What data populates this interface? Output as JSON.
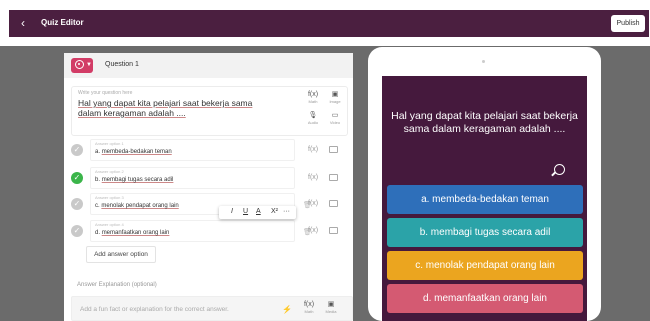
{
  "header": {
    "back_icon": "chevron-left-icon",
    "title": "Quiz Editor",
    "publish_label": "Publish"
  },
  "editor": {
    "question_number": "Question 1",
    "question_type_icon": "target-icon",
    "question_placeholder": "Write your question here",
    "question_text": "Hal yang dapat kita pelajari saat bekerja sama dalam keragaman adalah ....",
    "tools": [
      {
        "glyph": "f(x)",
        "label": "Math"
      },
      {
        "glyph": "▣",
        "label": "Image"
      },
      {
        "glyph": "🎙",
        "label": "Audio"
      },
      {
        "glyph": "▭",
        "label": "Video"
      }
    ],
    "answers": [
      {
        "placeholder": "Answer option 1",
        "prefix": "a.",
        "text": "membeda-bedakan teman",
        "correct": false
      },
      {
        "placeholder": "Answer option 2",
        "prefix": "b.",
        "text": "membagi tugas secara adil",
        "correct": true
      },
      {
        "placeholder": "Answer option 3",
        "prefix": "c.",
        "text": "menolak pendapat orang lain",
        "correct": false
      },
      {
        "placeholder": "Answer option 4",
        "prefix": "d.",
        "text": "memanfaatkan orang lain",
        "correct": false
      }
    ],
    "answer_fx": "f(x)",
    "format_bar": {
      "italic": "I",
      "underline": "U",
      "color": "A",
      "superscript": "X²",
      "more": "···"
    },
    "add_answer_label": "Add answer option",
    "explanation_label": "Answer Explanation (optional)",
    "explanation_placeholder": "Add a fun fact or explanation for the correct answer.",
    "explanation_tools": [
      {
        "glyph": "f(x)",
        "label": "Math"
      },
      {
        "glyph": "▣",
        "label": "Media"
      }
    ]
  },
  "preview": {
    "question_text": "Hal yang dapat kita pelajari saat bekerja sama dalam keragaman adalah ....",
    "options": [
      {
        "label": "a. membeda-bedakan teman",
        "color": "#2e6fba"
      },
      {
        "label": "b. membagi tugas secara adil",
        "color": "#2ba3a8"
      },
      {
        "label": "c. menolak pendapat orang lain",
        "color": "#eba51f"
      },
      {
        "label": "d. memanfaatkan orang lain",
        "color": "#d45a72"
      }
    ]
  },
  "colors": {
    "header_bg": "#4b1f40",
    "accent": "#d23c66",
    "correct": "#3bb54a"
  }
}
